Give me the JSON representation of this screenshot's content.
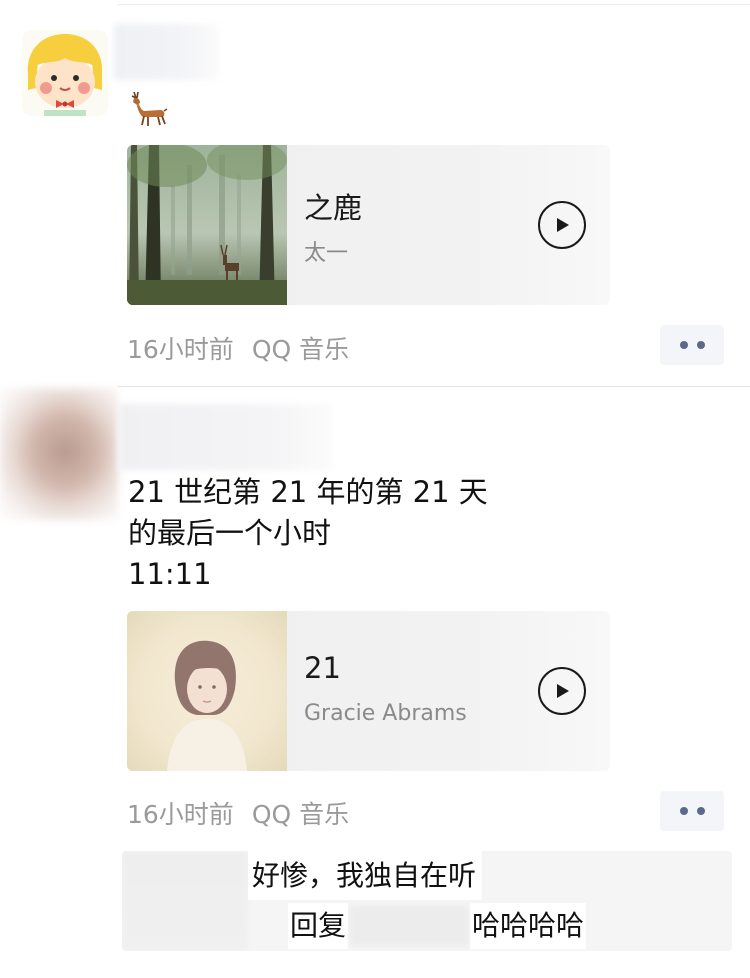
{
  "posts": [
    {
      "emoji": "deer",
      "music": {
        "title": "之鹿",
        "artist": "太一"
      },
      "meta": {
        "time": "16小时前",
        "source": "QQ 音乐"
      }
    },
    {
      "text_lines": [
        "21 世纪第 21 年的第 21 天",
        "的最后一个小时",
        "11:11"
      ],
      "music": {
        "title": "21",
        "artist": "Gracie Abrams"
      },
      "meta": {
        "time": "16小时前",
        "source": "QQ 音乐"
      },
      "comment": {
        "text": "好惨，我独自在听",
        "reply_prefix": "回复",
        "reply_text": "哈哈哈哈"
      }
    }
  ],
  "icons": {
    "play": "play-icon",
    "more": "more-dots-icon",
    "emoji": "deer-emoji-icon"
  },
  "colors": {
    "link_dots": "#5b6a8a",
    "meta_text": "#9a9a9a",
    "card_bg": "#efefef"
  }
}
